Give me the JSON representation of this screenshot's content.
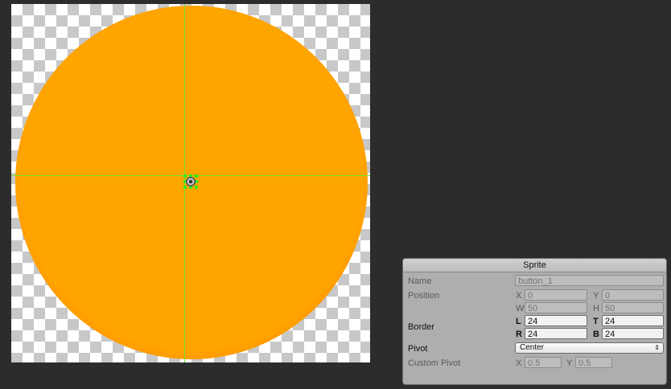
{
  "panel": {
    "title": "Sprite",
    "name_label": "Name",
    "name_value": "button_1",
    "position_label": "Position",
    "position": {
      "x_axis": "X",
      "x": "0",
      "y_axis": "Y",
      "y": "0",
      "w_axis": "W",
      "w": "50",
      "h_axis": "H",
      "h": "50"
    },
    "border_label": "Border",
    "border": {
      "l_axis": "L",
      "l": "24",
      "t_axis": "T",
      "t": "24",
      "r_axis": "R",
      "r": "24",
      "b_axis": "B",
      "b": "24"
    },
    "pivot_label": "Pivot",
    "pivot_value": "Center",
    "pivot_arrow": "⇕",
    "custom_pivot_label": "Custom Pivot",
    "custom_pivot": {
      "x_axis": "X",
      "x": "0.5",
      "y_axis": "Y",
      "y": "0.5"
    }
  },
  "colors": {
    "sprite_fill": "#ffa500",
    "guide_line": "#7ddf2a",
    "pivot_handle": "#39e61d"
  }
}
